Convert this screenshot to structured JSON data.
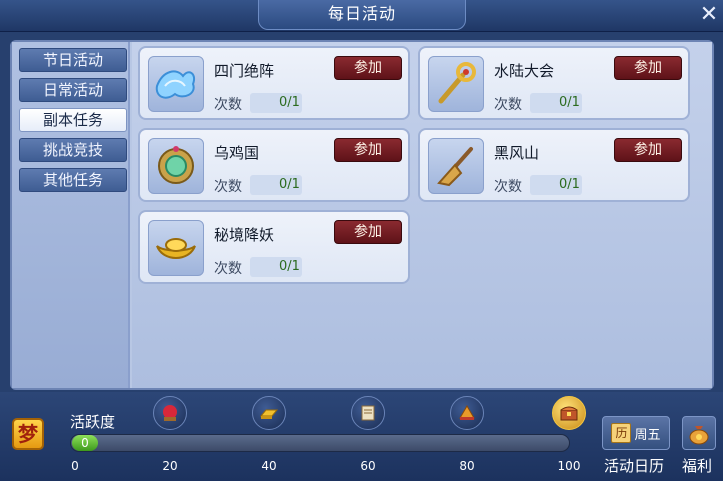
{
  "window": {
    "title": "每日活动",
    "close_icon": "✕"
  },
  "sidebar": {
    "items": [
      {
        "label": "节日活动",
        "active": false
      },
      {
        "label": "日常活动",
        "active": false
      },
      {
        "label": "副本任务",
        "active": true
      },
      {
        "label": "挑战竞技",
        "active": false
      },
      {
        "label": "其他任务",
        "active": false
      }
    ]
  },
  "activities": [
    {
      "name": "四门绝阵",
      "count_label": "次数",
      "count": "0/1",
      "join_label": "参加",
      "icon": "blue-crystal-icon"
    },
    {
      "name": "水陆大会",
      "count_label": "次数",
      "count": "0/1",
      "join_label": "参加",
      "icon": "golden-staff-icon"
    },
    {
      "name": "乌鸡国",
      "count_label": "次数",
      "count": "0/1",
      "join_label": "参加",
      "icon": "jade-mirror-icon"
    },
    {
      "name": "黑风山",
      "count_label": "次数",
      "count": "0/1",
      "join_label": "参加",
      "icon": "broom-icon"
    },
    {
      "name": "秘境降妖",
      "count_label": "次数",
      "count": "0/1",
      "join_label": "参加",
      "icon": "gold-ingot-icon"
    }
  ],
  "activity_meter": {
    "label": "活跃度",
    "value": "0",
    "progress": 0,
    "ticks": [
      "0",
      "20",
      "40",
      "60",
      "80",
      "100"
    ],
    "rewards": [
      "red-orb-icon",
      "gold-bar-icon",
      "scroll-icon",
      "treasure-icon",
      "chest-icon"
    ]
  },
  "bottom_buttons": {
    "dream_icon": "梦",
    "calendar_chip": "历",
    "calendar_day": "周五",
    "calendar_label": "活动日历",
    "welfare_label": "福利"
  },
  "colors": {
    "accent_join": "#6e1a20",
    "count_green": "#2b6b1f",
    "progress_green": "#5cbf2a"
  }
}
